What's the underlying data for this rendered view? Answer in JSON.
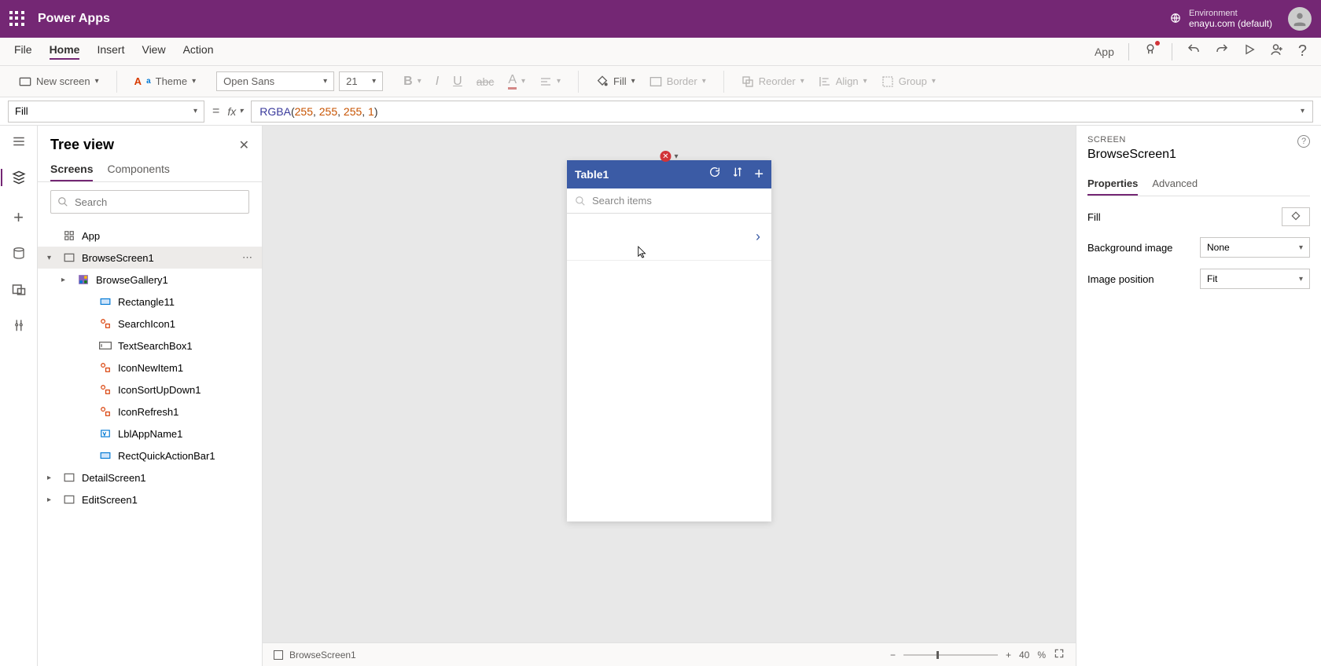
{
  "header": {
    "app_title": "Power Apps",
    "env_label": "Environment",
    "env_name": "enayu.com (default)"
  },
  "menubar": {
    "items": [
      "File",
      "Home",
      "Insert",
      "View",
      "Action"
    ],
    "active_index": 1,
    "right_label": "App"
  },
  "ribbon": {
    "new_screen": "New screen",
    "theme": "Theme",
    "font_name": "Open Sans",
    "font_size": "21",
    "fill": "Fill",
    "border": "Border",
    "reorder": "Reorder",
    "align": "Align",
    "group": "Group"
  },
  "formula": {
    "property": "Fill",
    "func": "RGBA",
    "args": [
      "255",
      "255",
      "255",
      "1"
    ]
  },
  "tree": {
    "title": "Tree view",
    "tabs": [
      "Screens",
      "Components"
    ],
    "active_tab": 0,
    "search_placeholder": "Search",
    "items": [
      {
        "label": "App",
        "depth": 0,
        "icon": "app",
        "expand": ""
      },
      {
        "label": "BrowseScreen1",
        "depth": 0,
        "icon": "screen",
        "expand": "v",
        "selected": true,
        "more": true
      },
      {
        "label": "BrowseGallery1",
        "depth": 1,
        "icon": "gallery",
        "expand": ">"
      },
      {
        "label": "Rectangle11",
        "depth": 2,
        "icon": "rect",
        "expand": ""
      },
      {
        "label": "SearchIcon1",
        "depth": 2,
        "icon": "iconctrl",
        "expand": ""
      },
      {
        "label": "TextSearchBox1",
        "depth": 2,
        "icon": "textbox",
        "expand": ""
      },
      {
        "label": "IconNewItem1",
        "depth": 2,
        "icon": "iconctrl",
        "expand": ""
      },
      {
        "label": "IconSortUpDown1",
        "depth": 2,
        "icon": "iconctrl",
        "expand": ""
      },
      {
        "label": "IconRefresh1",
        "depth": 2,
        "icon": "iconctrl",
        "expand": ""
      },
      {
        "label": "LblAppName1",
        "depth": 2,
        "icon": "label",
        "expand": ""
      },
      {
        "label": "RectQuickActionBar1",
        "depth": 2,
        "icon": "rect",
        "expand": ""
      },
      {
        "label": "DetailScreen1",
        "depth": 0,
        "icon": "screen",
        "expand": ">"
      },
      {
        "label": "EditScreen1",
        "depth": 0,
        "icon": "screen",
        "expand": ">"
      }
    ]
  },
  "device": {
    "title": "Table1",
    "search_placeholder": "Search items"
  },
  "statusbar": {
    "screen": "BrowseScreen1",
    "zoom": "40",
    "zoom_unit": "%"
  },
  "props": {
    "section": "SCREEN",
    "name": "BrowseScreen1",
    "tabs": [
      "Properties",
      "Advanced"
    ],
    "active_tab": 0,
    "rows": {
      "fill_label": "Fill",
      "bg_label": "Background image",
      "bg_value": "None",
      "pos_label": "Image position",
      "pos_value": "Fit"
    }
  }
}
